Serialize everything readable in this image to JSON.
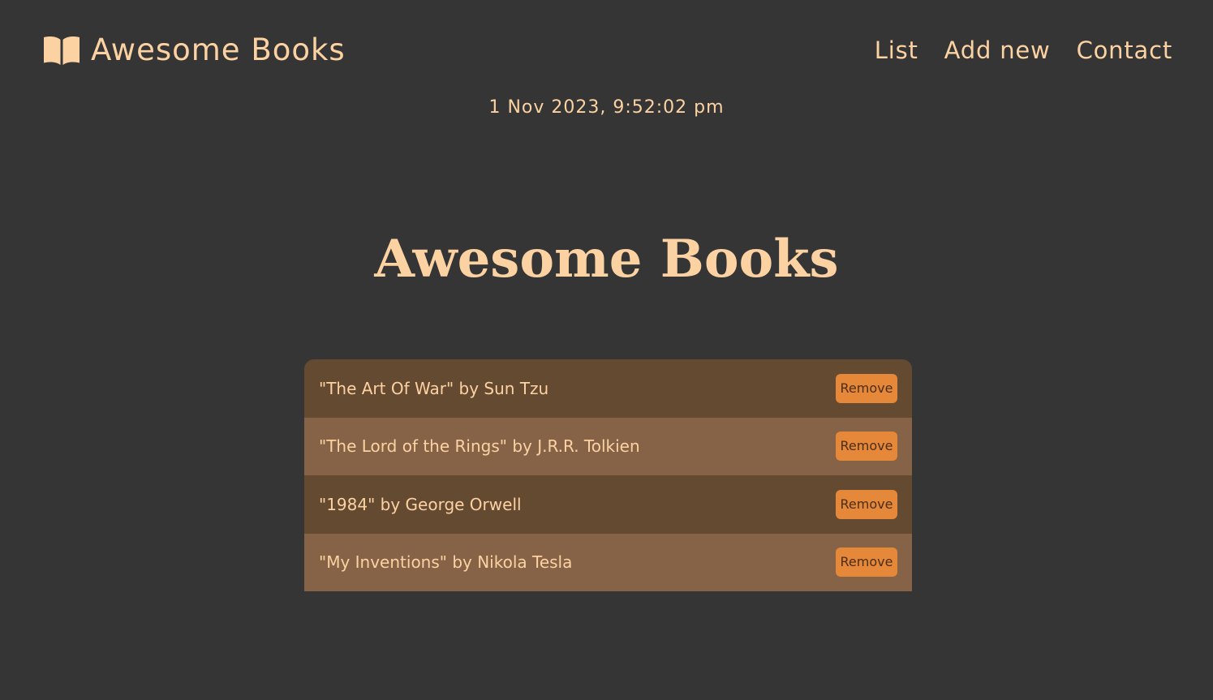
{
  "header": {
    "brand_icon": "open-book-icon",
    "brand_title": "Awesome Books",
    "nav": [
      {
        "label": "List"
      },
      {
        "label": "Add new"
      },
      {
        "label": "Contact"
      }
    ]
  },
  "datetime": "1 Nov 2023, 9:52:02 pm",
  "main": {
    "title": "Awesome Books",
    "books": [
      {
        "text": "\"The Art Of War\" by Sun Tzu",
        "button": "Remove"
      },
      {
        "text": "\"The Lord of the Rings\" by J.R.R. Tolkien",
        "button": "Remove"
      },
      {
        "text": "\"1984\" by George Orwell",
        "button": "Remove"
      },
      {
        "text": "\"My Inventions\" by Nikola Tesla",
        "button": "Remove"
      }
    ]
  },
  "colors": {
    "background": "#353535",
    "accent_text": "#fcd2a2",
    "row_dark": "#654a32",
    "row_light": "#866347",
    "button": "#e6883a"
  }
}
